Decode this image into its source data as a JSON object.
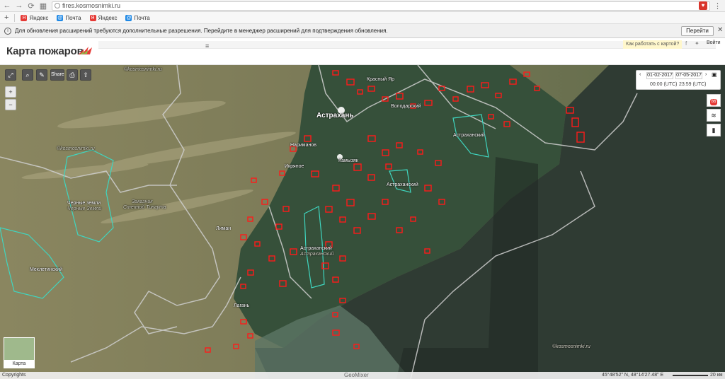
{
  "browser": {
    "url": "fires.kosmosnimki.ru",
    "bookmarks": [
      {
        "label": "Яндекс",
        "color": "#e53935",
        "icon": "yandex-icon"
      },
      {
        "label": "Почта",
        "color": "#1e88e5",
        "icon": "mail-icon"
      },
      {
        "label": "Яндекс",
        "color": "#e53935",
        "icon": "yandex-icon"
      },
      {
        "label": "Почта",
        "color": "#1e88e5",
        "icon": "mail-icon"
      }
    ],
    "infobar_text": "Для обновления расширений требуются дополнительные разрешения. Перейдите в менеджер расширений для подтверждения обновления.",
    "infobar_button": "Перейти"
  },
  "app": {
    "title": "Карта пожаров",
    "howto": "Как работать с картой?",
    "login": "Войти"
  },
  "toolbar": {
    "share_label": "Share"
  },
  "dates": {
    "from_date": "01-02-2017",
    "to_date": "07-05-2017",
    "from_time": "00:00 (UTC)",
    "to_time": "23:59 (UTC)"
  },
  "badges": {
    "fires_count": "86"
  },
  "map_labels": {
    "astrakhan": "Астрахань",
    "krasny_yar": "Красный Яр",
    "volodarsky": "Володарский",
    "astrakhansky_ne": "Астраханский",
    "kamyzyak": "Камызяк",
    "ikryanoye": "Икряное",
    "narimanov": "Нариманов",
    "astrakhansky_mid": "Астраханский",
    "liman": "Лиман",
    "astrakhansky_s": "Астраханский",
    "astrakhansky_s_sub": "Астраханский",
    "lagan": "Лагань",
    "cherny_zemli": "Черные земли",
    "cherny_zemli_sub": "Черные Земли",
    "zakaznik": "Заказник",
    "zakaznik_sub": "Степной Тингута",
    "mekletinsky": "Меклетинский",
    "watermark": "©kosmosnimki.ru"
  },
  "minimap": {
    "label": "Карта"
  },
  "status": {
    "copyrights": "Copyrights",
    "geomixer": "GeoMixer",
    "coords": "45°48'52\" N, 48°14'27.48\" E",
    "scale": "20 км"
  },
  "colors": {
    "fire": "#ff1a1a",
    "reserve_outline": "#3fd6c0",
    "border": "#c9c9c9",
    "sea": "#2f3b33",
    "brand": "#e53935"
  }
}
